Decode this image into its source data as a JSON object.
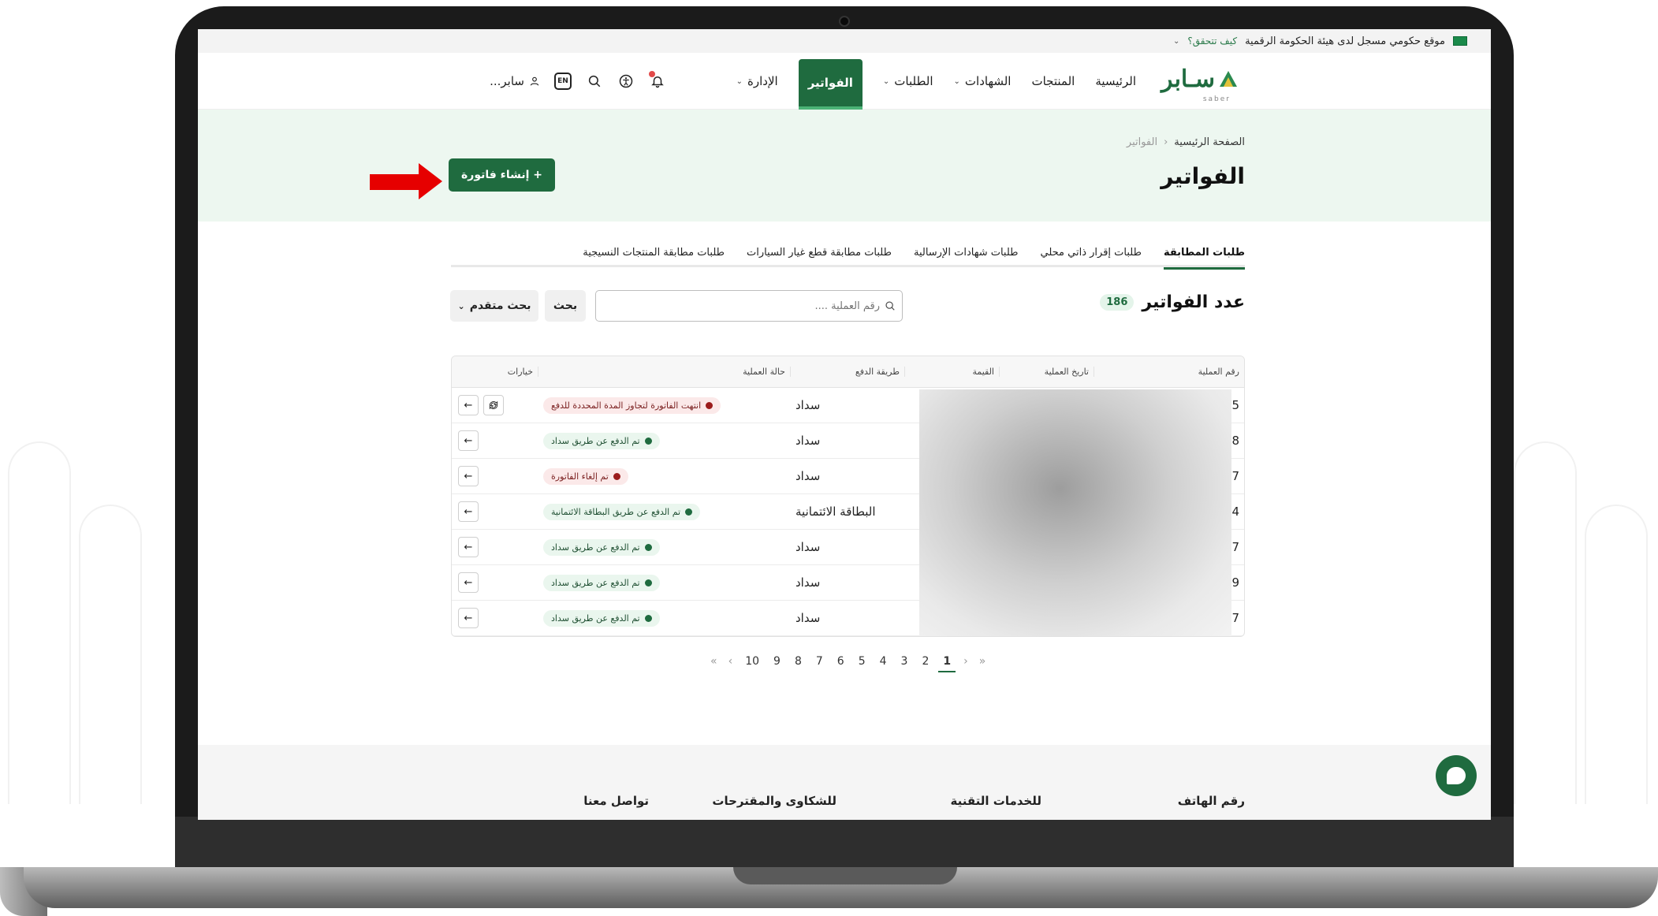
{
  "gov_bar": {
    "text": "موقع حكومي مسجل لدى هيئة الحكومة الرقمية",
    "verify": "كيف تتحقق؟"
  },
  "logo": {
    "text": "سـابر",
    "sub": "saber"
  },
  "nav": {
    "items": [
      {
        "label": "الرئيسية",
        "has_dropdown": false
      },
      {
        "label": "المنتجات",
        "has_dropdown": false
      },
      {
        "label": "الشهادات",
        "has_dropdown": true
      },
      {
        "label": "الطلبات",
        "has_dropdown": true
      },
      {
        "label": "الفواتير",
        "has_dropdown": false,
        "active": true
      },
      {
        "label": "الإدارة",
        "has_dropdown": true
      }
    ]
  },
  "tools": {
    "lang": "EN",
    "user_name": "سابر..."
  },
  "breadcrumb": {
    "home": "الصفحة الرئيسية",
    "current": "الفواتير"
  },
  "page_title": "الفواتير",
  "create_button": "+ إنشاء فاتورة",
  "tabs": [
    {
      "label": "طلبات المطابقة",
      "active": true
    },
    {
      "label": "طلبات إقرار ذاتي محلي"
    },
    {
      "label": "طلبات شهادات الإرسالية"
    },
    {
      "label": "طلبات مطابقة قطع غيار السيارات"
    },
    {
      "label": "طلبات مطابقة المنتجات النسيجية"
    }
  ],
  "count": {
    "title": "عدد الفواتير",
    "value": "186"
  },
  "search": {
    "placeholder": "رقم العملية ....",
    "button": "بحث",
    "advanced": "بحث متقدم"
  },
  "table": {
    "headers": {
      "num": "رقم العملية",
      "date": "تاريخ العملية",
      "value": "القيمة",
      "payment": "طريقة الدفع",
      "status": "حالة العملية",
      "options": "خيارات"
    },
    "rows": [
      {
        "num": "5",
        "payment": "سداد",
        "status": "انتهت الفاتورة لتجاوز المدة المحددة للدفع",
        "status_type": "bad",
        "has_refresh": true
      },
      {
        "num": "8",
        "payment": "سداد",
        "status": "تم الدفع عن طريق سداد",
        "status_type": "ok"
      },
      {
        "num": "7",
        "payment": "سداد",
        "status": "تم إلغاء الفاتورة",
        "status_type": "bad"
      },
      {
        "num": "4",
        "payment": "البطاقة الائتمانية",
        "status": "تم الدفع عن طريق البطاقة الائتمانية",
        "status_type": "ok"
      },
      {
        "num": "7",
        "payment": "سداد",
        "status": "تم الدفع عن طريق سداد",
        "status_type": "ok"
      },
      {
        "num": "9",
        "payment": "سداد",
        "status": "تم الدفع عن طريق سداد",
        "status_type": "ok"
      },
      {
        "num": "7",
        "payment": "سداد",
        "status": "تم الدفع عن طريق سداد",
        "status_type": "ok"
      }
    ]
  },
  "pagination": {
    "pages": [
      "10",
      "9",
      "8",
      "7",
      "6",
      "5",
      "4",
      "3",
      "2",
      "1"
    ],
    "current": "1"
  },
  "footer": {
    "phone": "رقم الهاتف",
    "tech": "للخدمات التقنية",
    "complaints": "للشكاوى والمقترحات",
    "contact": "تواصل معنا"
  },
  "colors": {
    "brand": "#1f6b3f",
    "hero_bg": "#edf7f0",
    "arrow": "#e60000"
  }
}
